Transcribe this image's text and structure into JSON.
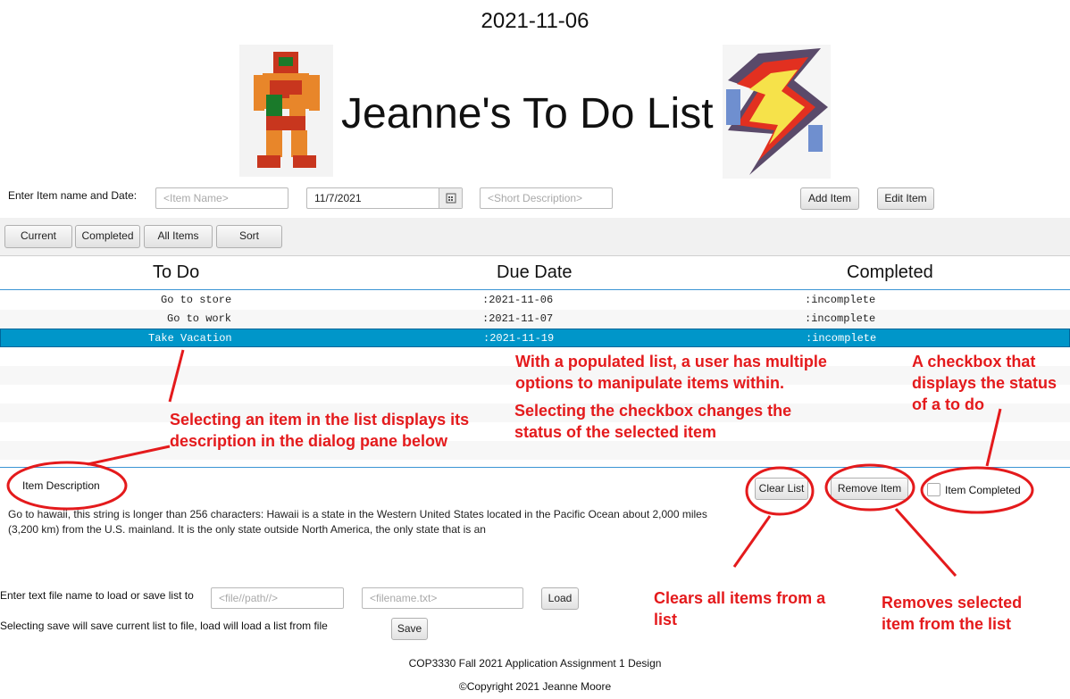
{
  "header": {
    "date": "2021-11-06",
    "title": "Jeanne's To Do List"
  },
  "entry": {
    "label": "Enter Item name and Date:",
    "item_name_placeholder": "<Item Name>",
    "date_value": "11/7/2021",
    "description_placeholder": "<Short Description>",
    "add_button": "Add Item",
    "edit_button": "Edit Item"
  },
  "toolbar": {
    "current": "Current",
    "completed": "Completed",
    "all_items": "All Items",
    "sort": "Sort"
  },
  "table": {
    "columns": [
      "To Do",
      "Due Date",
      "Completed"
    ],
    "rows": [
      {
        "todo": "Go to store",
        "due": ":2021-11-06",
        "status": ":incomplete"
      },
      {
        "todo": "Go to work",
        "due": ":2021-11-07",
        "status": ":incomplete"
      },
      {
        "todo": "Take Vacation",
        "due": ":2021-11-19",
        "status": ":incomplete"
      }
    ],
    "selected_index": 2
  },
  "detail": {
    "label": "Item Description",
    "text": "Go to hawaii, this string is longer than 256 characters: Hawaii  is a state in the Western United States located in the Pacific Ocean about 2,000 miles (3,200 km) from the U.S. mainland. It is the only state outside North America, the only state that is an",
    "clear_button": "Clear List",
    "remove_button": "Remove Item",
    "completed_checkbox": "Item Completed"
  },
  "file": {
    "label1": "Enter text file name to load or save list to",
    "label2": "Selecting save will save current list to file, load will load a list from file",
    "path_placeholder": "<file//path//>",
    "filename_placeholder": "<filename.txt>",
    "load_button": "Load",
    "save_button": "Save"
  },
  "footer": {
    "line1": "COP3330 Fall 2021 Application Assignment 1 Design",
    "line2": "©Copyright 2021 Jeanne Moore"
  },
  "annotations": {
    "select_item": "Selecting an item in the list displays its description in the dialog pane below",
    "populated": "With a populated list, a user has multiple options to manipulate items within.",
    "checkbox_changes": "Selecting the checkbox changes the status of the selected item",
    "checkbox_status": "A checkbox that displays the status of a to do",
    "clears": "Clears all items from a list",
    "removes": "Removes selected item from the list"
  },
  "colors": {
    "annotation": "#e41a1c",
    "selection": "#0096c9",
    "table_border": "#3b95d4"
  }
}
